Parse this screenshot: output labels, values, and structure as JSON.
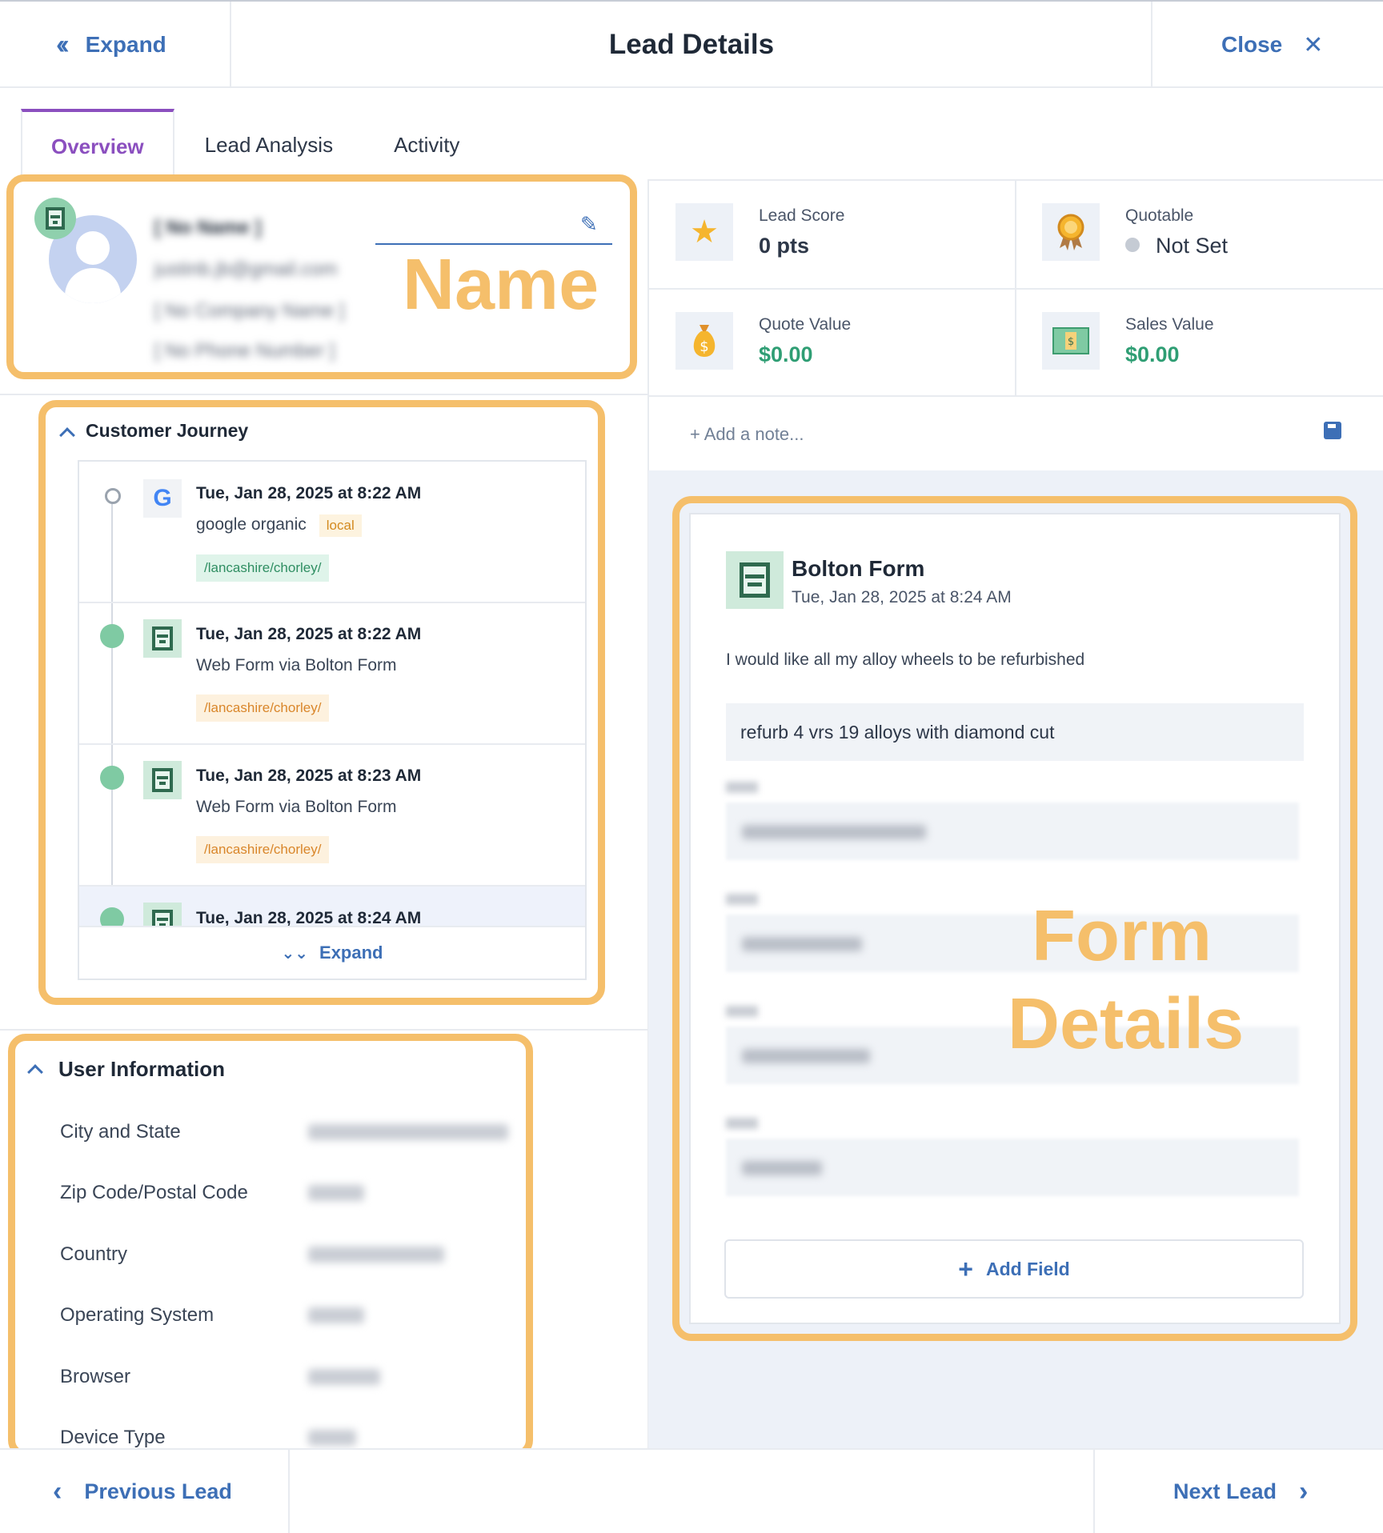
{
  "header": {
    "expand_label": "Expand",
    "title": "Lead Details",
    "close_label": "Close"
  },
  "tabs": [
    {
      "label": "Overview",
      "active": true
    },
    {
      "label": "Lead Analysis",
      "active": false
    },
    {
      "label": "Activity",
      "active": false
    }
  ],
  "profile": {
    "name": "[ No Name ]",
    "email": "justinb.jb@gmail.com",
    "company": "[ No Company Name ]",
    "phone": "[ No Phone Number ]",
    "overlay_label": "Name"
  },
  "stats": {
    "lead_score": {
      "label": "Lead Score",
      "value": "0 pts",
      "icon": "star-icon"
    },
    "quotable": {
      "label": "Quotable",
      "value": "Not Set",
      "icon": "award-ribbon-icon"
    },
    "quote_value": {
      "label": "Quote Value",
      "value": "$0.00",
      "icon": "money-bag-icon"
    },
    "sales_value": {
      "label": "Sales Value",
      "value": "$0.00",
      "icon": "cash-icon"
    }
  },
  "note": {
    "placeholder": "+ Add a note..."
  },
  "customer_journey": {
    "title": "Customer Journey",
    "items": [
      {
        "date": "Tue, Jan 28, 2025 at 8:22 AM",
        "source": "google organic",
        "tag": "local",
        "path": "/lancashire/chorley/"
      },
      {
        "date": "Tue, Jan 28, 2025 at 8:22 AM",
        "source": "Web Form via Bolton Form",
        "path": "/lancashire/chorley/"
      },
      {
        "date": "Tue, Jan 28, 2025 at 8:23 AM",
        "source": "Web Form via Bolton Form",
        "path": "/lancashire/chorley/"
      },
      {
        "date": "Tue, Jan 28, 2025 at 8:24 AM"
      }
    ],
    "expand_label": "Expand"
  },
  "user_info": {
    "title": "User Information",
    "rows": [
      {
        "label": "City and State"
      },
      {
        "label": "Zip Code/Postal Code"
      },
      {
        "label": "Country"
      },
      {
        "label": "Operating System"
      },
      {
        "label": "Browser"
      },
      {
        "label": "Device Type"
      }
    ]
  },
  "form_details": {
    "title": "Bolton Form",
    "date": "Tue, Jan 28, 2025 at 8:24 AM",
    "description": "I would like all my alloy wheels to be refurbished",
    "message": "refurb 4 vrs 19 alloys with diamond cut",
    "add_field_label": "Add Field",
    "overlay_label_1": "Form",
    "overlay_label_2": "Details"
  },
  "footer": {
    "prev_label": "Previous Lead",
    "next_label": "Next Lead"
  },
  "colors": {
    "accent_blue": "#3d6fb6",
    "active_tab_purple": "#8b4fbf",
    "highlight_orange": "#f5bf6b",
    "money_green": "#2f9e74"
  }
}
